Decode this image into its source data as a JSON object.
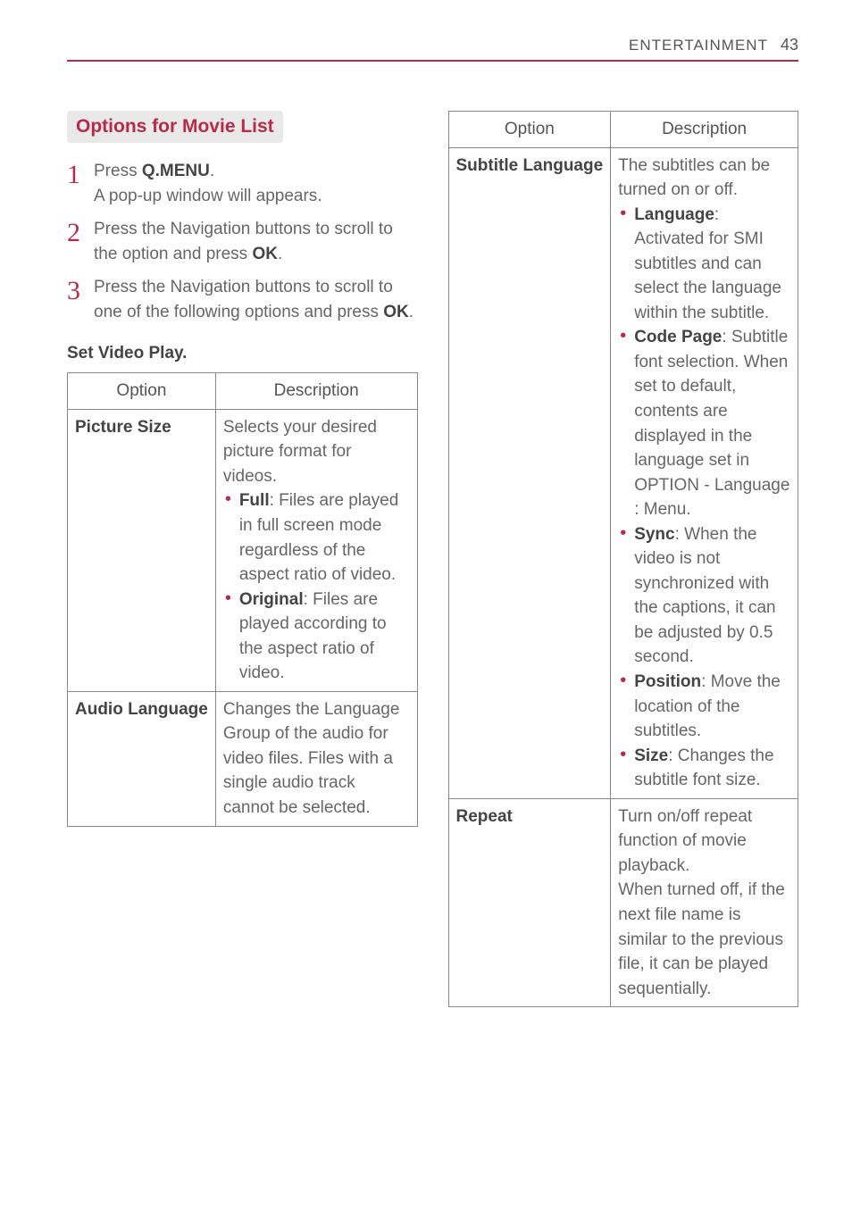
{
  "header": {
    "section": "ENTERTAINMENT",
    "page": "43"
  },
  "left": {
    "title": "Options for Movie List",
    "steps": [
      {
        "pre": "Press ",
        "bold": "Q.MENU",
        "post": ".",
        "line2": "A pop-up window will appears."
      },
      {
        "pre": "Press the Navigation buttons to scroll to the option and press ",
        "bold": "OK",
        "post": "."
      },
      {
        "pre": "Press the Navigation buttons to scroll to one of the following options and press ",
        "bold": "OK",
        "post": "."
      }
    ],
    "subheading": "Set Video Play.",
    "table": {
      "head": {
        "c1": "Option",
        "c2": "Description"
      },
      "rows": [
        {
          "name": "Picture Size",
          "intro": "Selects your desired picture format for videos.",
          "items": [
            {
              "bold": "Full",
              "text": ": Files are played in full screen mode regardless of the aspect ratio of video."
            },
            {
              "bold": "Original",
              "text": ": Files are played according to the aspect ratio of video."
            }
          ]
        },
        {
          "name": "Audio Language",
          "intro": "Changes the Language Group of the audio for video files. Files with a single audio track cannot be selected.",
          "items": []
        }
      ]
    }
  },
  "right": {
    "table": {
      "head": {
        "c1": "Option",
        "c2": "Description"
      },
      "rows": [
        {
          "name": "Subtitle Language",
          "intro": "The subtitles can be turned on or off.",
          "items": [
            {
              "bold": "Language",
              "text": ": Activated for SMI subtitles and can select the language within the subtitle."
            },
            {
              "bold": "Code Page",
              "text": ": Subtitle font selection. When set to default, contents are displayed in the language set in OPTION - Language : Menu."
            },
            {
              "bold": "Sync",
              "text": ": When the video is not synchronized with the captions, it can be adjusted by 0.5 second."
            },
            {
              "bold": "Position",
              "text": ": Move the location of the subtitles."
            },
            {
              "bold": "Size",
              "text": ": Changes the subtitle font size."
            }
          ]
        },
        {
          "name": "Repeat",
          "intro": "Turn on/off repeat function of movie playback.",
          "extra": "When turned off, if the next file name is similar to the previous file, it can be played sequentially.",
          "items": []
        }
      ]
    }
  }
}
